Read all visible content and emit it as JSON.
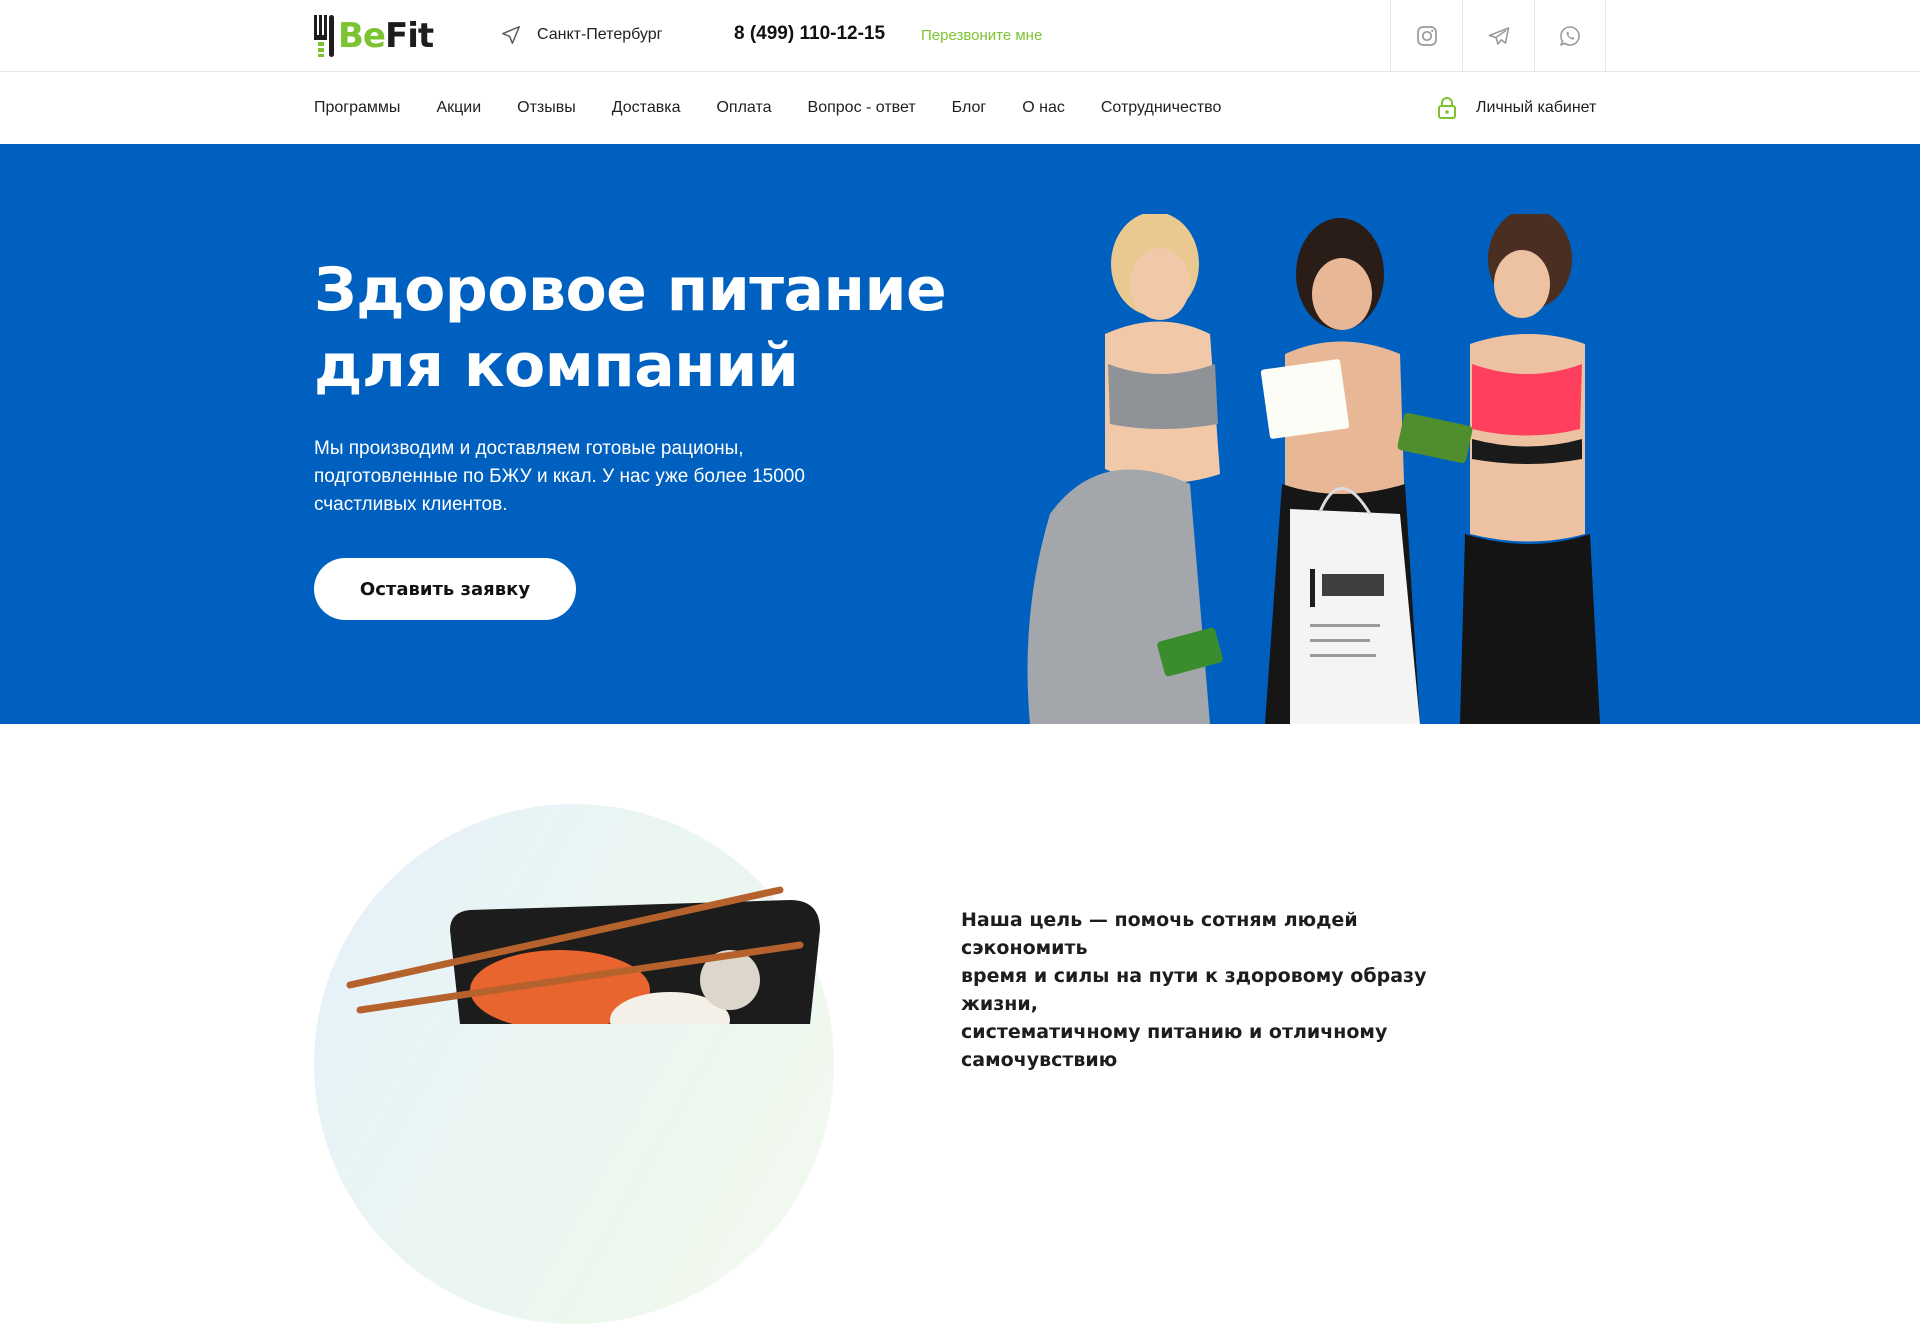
{
  "brand": {
    "logo_be": "Be",
    "logo_fit": "Fit",
    "accent_color": "#7cc331",
    "hero_color": "#0060bf"
  },
  "header": {
    "city": "Санкт-Петербург",
    "phone": "8 (499) 110-12-15",
    "callback": "Перезвоните мне",
    "socials": [
      "instagram-icon",
      "telegram-icon",
      "whatsapp-icon"
    ]
  },
  "nav": {
    "items": [
      "Программы",
      "Акции",
      "Отзывы",
      "Доставка",
      "Оплата",
      "Вопрос - ответ",
      "Блог",
      "О нас",
      "Сотрудничество"
    ],
    "account": "Личный кабинет"
  },
  "hero": {
    "title_line1": "Здоровое питание",
    "title_line2": "для компаний",
    "text": "Мы производим и доставляем готовые рационы, подготовленные по БЖУ и ккал. У нас уже более 15000 счастливых клиентов.",
    "button": "Оставить заявку"
  },
  "goal": {
    "line1": "Наша цель — помочь сотням людей сэкономить",
    "line2": "время и силы на пути к здоровому образу жизни,",
    "line3": "систематичному питанию и отличному",
    "line4": "самочувствию"
  }
}
